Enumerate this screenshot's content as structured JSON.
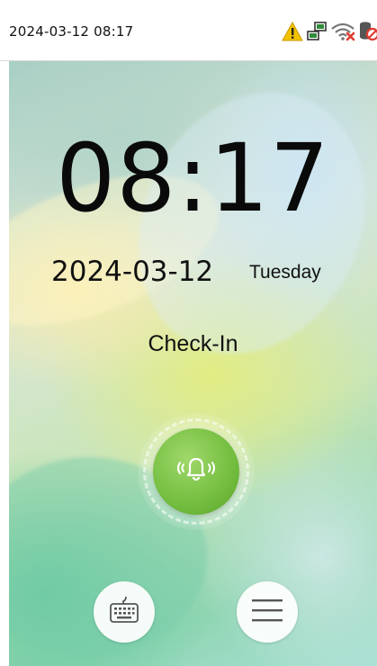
{
  "status_bar": {
    "datetime": "2024-03-12 08:17",
    "icons": [
      "warning-icon",
      "network-icon",
      "wifi-disconnected-icon",
      "server-offline-icon"
    ],
    "warning_color": "#f2c200",
    "error_color": "#e03a2f"
  },
  "main": {
    "time": "08:17",
    "date": "2024-03-12",
    "weekday": "Tuesday",
    "mode": "Check-In"
  },
  "controls": {
    "bell_icon": "doorbell-icon",
    "bell_color": "#73bd3f",
    "keyboard_icon": "keyboard-icon",
    "menu_icon": "menu-icon"
  }
}
